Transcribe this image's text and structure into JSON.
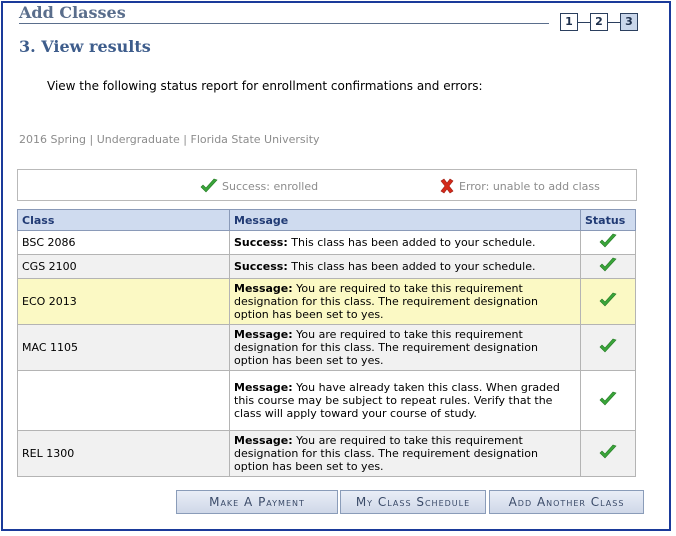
{
  "header": {
    "title": "Add Classes",
    "steps": [
      "1",
      "2",
      "3"
    ],
    "active_step": 3
  },
  "section": {
    "title": "3.  View results",
    "intro": "View the following status report for enrollment confirmations and errors:"
  },
  "term_line": "2016 Spring | Undergraduate | Florida State University",
  "legend": {
    "success": "Success: enrolled",
    "error": "Error: unable to add class"
  },
  "table": {
    "headers": [
      "Class",
      "Message",
      "Status"
    ],
    "rows": [
      {
        "class": "BSC 2086",
        "label": "Success:",
        "text": " This class has been added to your schedule.",
        "status": "success"
      },
      {
        "class": "CGS 2100",
        "label": "Success:",
        "text": " This class has been added to your schedule.",
        "status": "success"
      },
      {
        "class": "ECO 2013",
        "label": "Message:",
        "text": " You are required to take this requirement designation for this class. The requirement designation option has been set to yes.",
        "status": "success"
      },
      {
        "class": "MAC 1105",
        "label": "Message:",
        "text": " You are required to take this requirement designation for this class. The requirement designation option has been set to yes.",
        "status": "success"
      },
      {
        "class": "",
        "label": "Message:",
        "text": " You have already taken this class. When graded this course may be subject to repeat rules. Verify that the class will apply toward your course of study.",
        "status": "success"
      },
      {
        "class": "REL 1300",
        "label": "Message:",
        "text": " You are required to take this requirement designation for this class. The requirement designation option has been set to yes.",
        "status": "success"
      }
    ]
  },
  "buttons": {
    "payment": "Make A Payment",
    "schedule": "My Class Schedule",
    "add_another": "Add Another Class"
  },
  "colors": {
    "frame": "#1a3a9a",
    "title": "#5a6e8c",
    "section_title": "#3e5d8c",
    "header_bg": "#cfdbef",
    "highlight_row": "#fbf9c4",
    "success": "#3aa53a",
    "error": "#d42a1a"
  }
}
